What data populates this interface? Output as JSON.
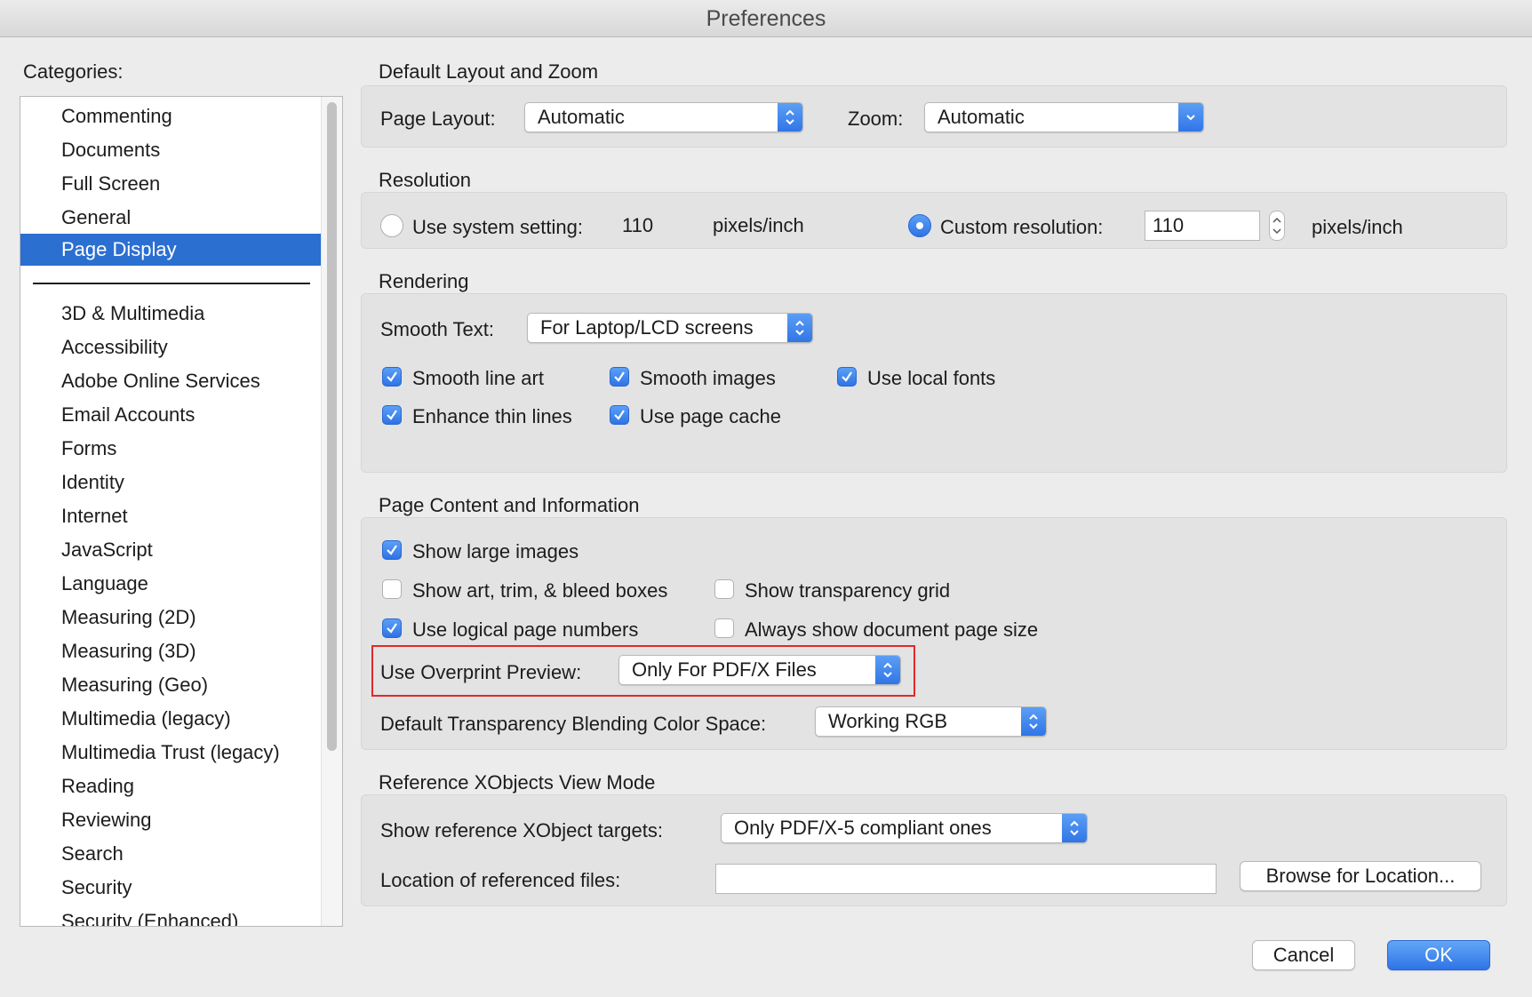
{
  "window": {
    "title": "Preferences"
  },
  "categories": {
    "label": "Categories:",
    "items": [
      "Commenting",
      "Documents",
      "Full Screen",
      "General",
      "Page Display"
    ],
    "selected": "Page Display",
    "more": [
      "3D & Multimedia",
      "Accessibility",
      "Adobe Online Services",
      "Email Accounts",
      "Forms",
      "Identity",
      "Internet",
      "JavaScript",
      "Language",
      "Measuring (2D)",
      "Measuring (3D)",
      "Measuring (Geo)",
      "Multimedia (legacy)",
      "Multimedia Trust (legacy)",
      "Reading",
      "Reviewing",
      "Search",
      "Security",
      "Security (Enhanced)"
    ]
  },
  "layout_zoom": {
    "title": "Default Layout and Zoom",
    "page_layout_label": "Page Layout:",
    "page_layout_value": "Automatic",
    "zoom_label": "Zoom:",
    "zoom_value": "Automatic"
  },
  "resolution": {
    "title": "Resolution",
    "system_label": "Use system setting:",
    "system_value": "110",
    "system_unit": "pixels/inch",
    "custom_label": "Custom resolution:",
    "custom_value": "110",
    "custom_unit": "pixels/inch",
    "selected": "custom"
  },
  "rendering": {
    "title": "Rendering",
    "smooth_text_label": "Smooth Text:",
    "smooth_text_value": "For Laptop/LCD screens",
    "smooth_line_art": "Smooth line art",
    "smooth_images": "Smooth images",
    "use_local_fonts": "Use local fonts",
    "enhance_thin_lines": "Enhance thin lines",
    "use_page_cache": "Use page cache"
  },
  "page_content": {
    "title": "Page Content and Information",
    "show_large_images": "Show large images",
    "show_art_trim": "Show art, trim, & bleed boxes",
    "show_transparency_grid": "Show transparency grid",
    "use_logical_page_numbers": "Use logical page numbers",
    "always_show_page_size": "Always show document page size",
    "overprint_label": "Use Overprint Preview:",
    "overprint_value": "Only For PDF/X Files",
    "blend_label": "Default Transparency Blending Color Space:",
    "blend_value": "Working RGB"
  },
  "xobjects": {
    "title": "Reference XObjects View Mode",
    "targets_label": "Show reference XObject targets:",
    "targets_value": "Only PDF/X-5 compliant ones",
    "location_label": "Location of referenced files:",
    "location_value": "",
    "browse_label": "Browse for Location..."
  },
  "footer": {
    "cancel_label": "Cancel",
    "ok_label": "OK"
  },
  "colors": {
    "accent": "#2f74e6",
    "selection": "#2b6fd1",
    "highlight": "#e0292a"
  }
}
